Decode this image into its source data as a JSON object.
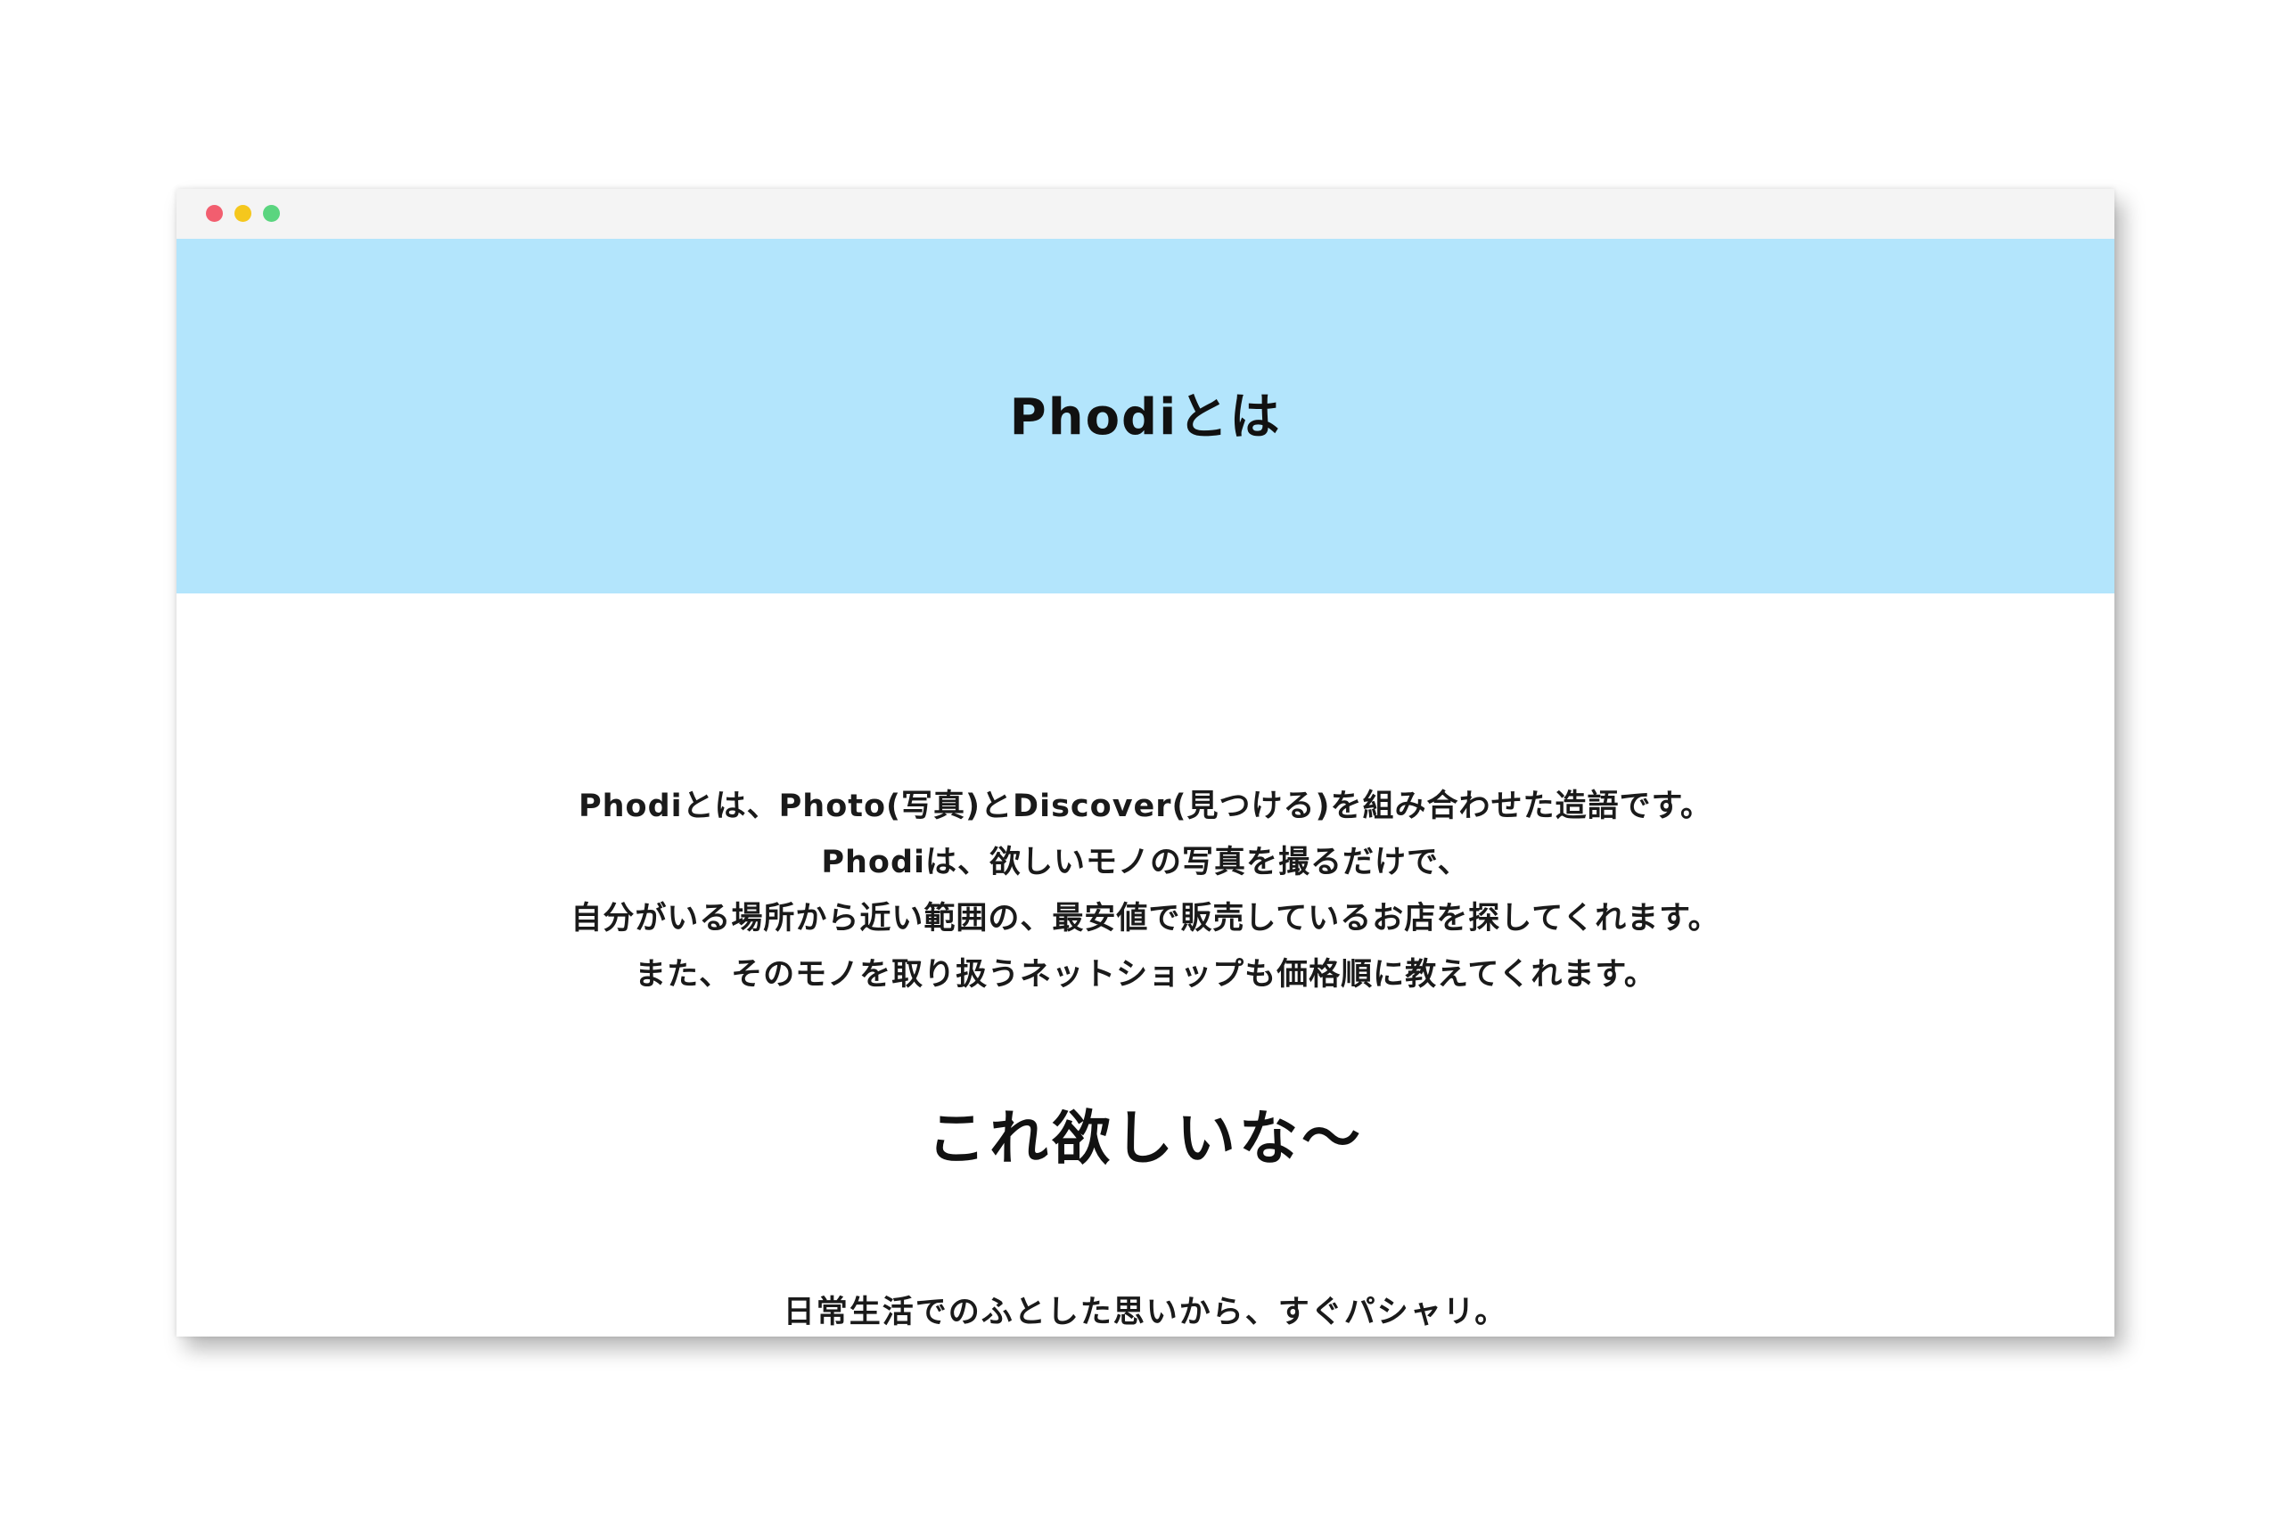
{
  "colors": {
    "titlebar": "#f4f4f4",
    "hero_bg": "#b3e5fc",
    "dot_red": "#f25e6f",
    "dot_yellow": "#f5c71d",
    "dot_green": "#5ad57f"
  },
  "hero": {
    "title": "Phodiとは"
  },
  "intro": {
    "lines": [
      "Phodiとは、Photo(写真)とDiscover(見つける)を組み合わせた造語です。",
      "Phodiは、欲しいモノの写真を撮るだけで、",
      "自分がいる場所から近い範囲の、最安値で販売しているお店を探してくれます。",
      "また、そのモノを取り扱うネットショップも価格順に教えてくれます。"
    ]
  },
  "catch": {
    "heading": "これ欲しいな〜"
  },
  "sub": {
    "text": "日常生活でのふとした思いから、すぐパシャリ。"
  }
}
